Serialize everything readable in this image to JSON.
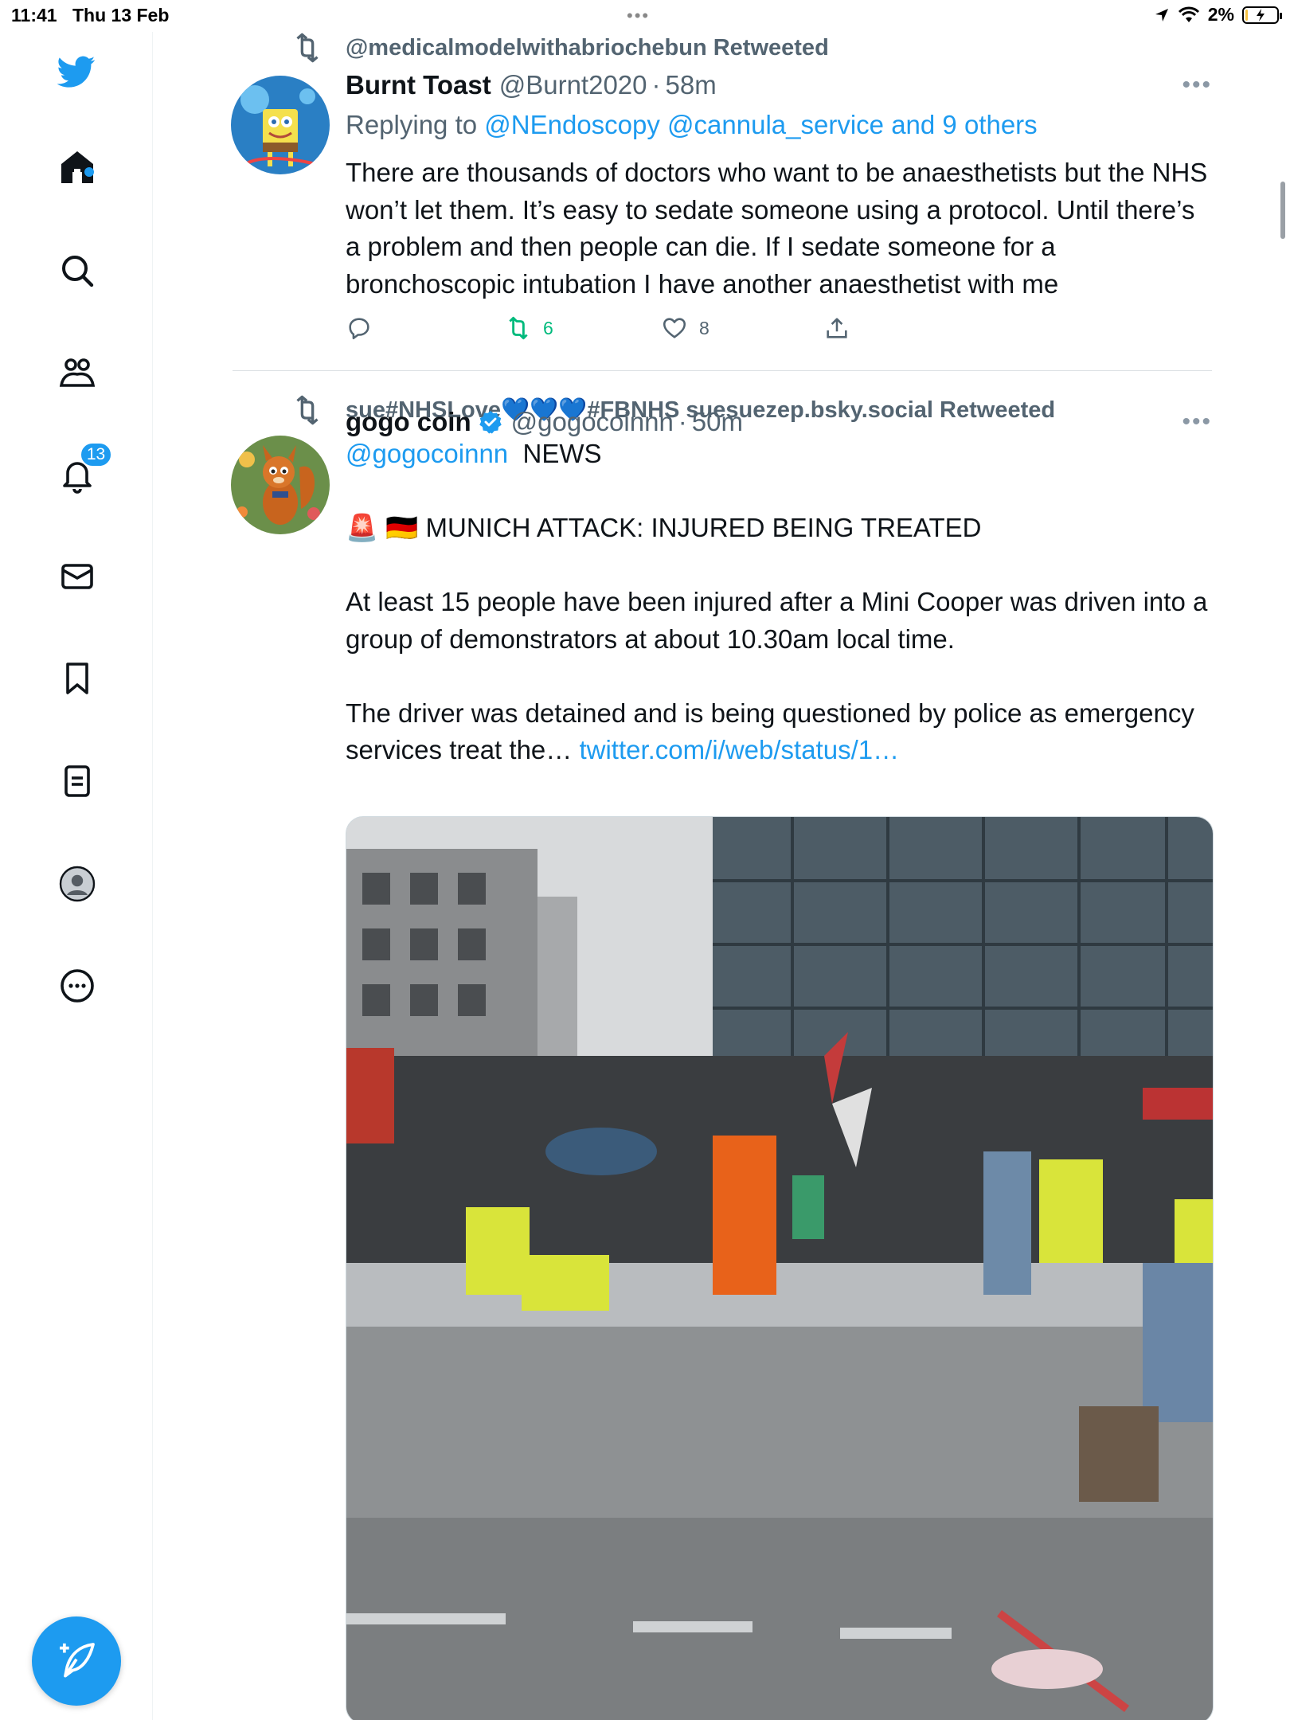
{
  "status_bar": {
    "time": "11:41",
    "date": "Thu 13 Feb",
    "battery": "2%"
  },
  "sidebar": {
    "notifications_badge": "13"
  },
  "tweets": [
    {
      "retweeted_by": "@medicalmodelwithabriochebun Retweeted",
      "name": "Burnt Toast",
      "handle": "@Burnt2020",
      "sep": "·",
      "time": "58m",
      "replying_prefix": "Replying to",
      "replying_links": "@NEndoscopy @cannula_service and 9 others",
      "text": "There are thousands of doctors who want to be anaesthetists but the NHS won’t let them. It’s easy to sedate someone using a protocol. Until there’s a problem and then people can die. If I sedate someone for a bronchoscopic intubation I have another anaesthetist with me",
      "retweets": "6",
      "likes": "8"
    },
    {
      "retweeted_by": "sue#NHSLove💙💙💙#FBNHS suesuezep.bsky.social Retweeted",
      "name": "gogo coin",
      "handle": "@gogocoinnn",
      "sep": "·",
      "time": "50m",
      "mention": "@gogocoinnn",
      "news_label": "NEWS",
      "headline_emoji": "🚨 🇩🇪",
      "headline": "MUNICH ATTACK: INJURED BEING TREATED",
      "para1": "At least 15 people have been injured after a Mini Cooper was driven into a group of demonstrators at about 10.30am local time.",
      "para2": "The driver was detained and is being questioned by police as emergency services treat the…",
      "link": "twitter.com/i/web/status/1…"
    }
  ],
  "colors": {
    "accent": "#1d9bf0",
    "retweet_green": "#00ba7c",
    "secondary_text": "#536471"
  }
}
